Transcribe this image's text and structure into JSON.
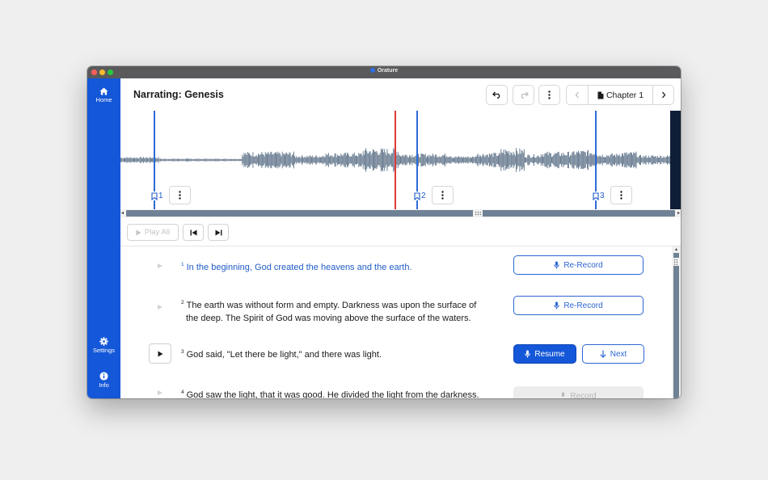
{
  "window": {
    "title": "Orature"
  },
  "sidebar": {
    "home": "Home",
    "settings": "Settings",
    "info": "Info"
  },
  "header": {
    "title": "Narrating: Genesis",
    "chapter_label": "Chapter 1"
  },
  "markers": [
    {
      "label": "1"
    },
    {
      "label": "2"
    },
    {
      "label": "3"
    }
  ],
  "controls": {
    "play_all": "Play All"
  },
  "verses": [
    {
      "number": "1",
      "text": "In the beginning, God created the heavens and the earth.",
      "button": "Re-Record"
    },
    {
      "number": "2",
      "text_line1": "The earth was without form and empty. Darkness was upon the surface of",
      "text_line2": "the deep. The Spirit of God was moving above the surface of the waters.",
      "button": "Re-Record"
    },
    {
      "number": "3",
      "text": "God said, \"Let there be light,\" and there was light.",
      "resume": "Resume",
      "next": "Next"
    },
    {
      "number": "4",
      "text": "God saw the light, that it was good. He divided the light from the darkness.",
      "button": "Record"
    }
  ],
  "colors": {
    "sidebar": "#1457d8",
    "accent": "#2c66d3",
    "playhead": "#e03a3a",
    "waveform": "#6f8195"
  }
}
